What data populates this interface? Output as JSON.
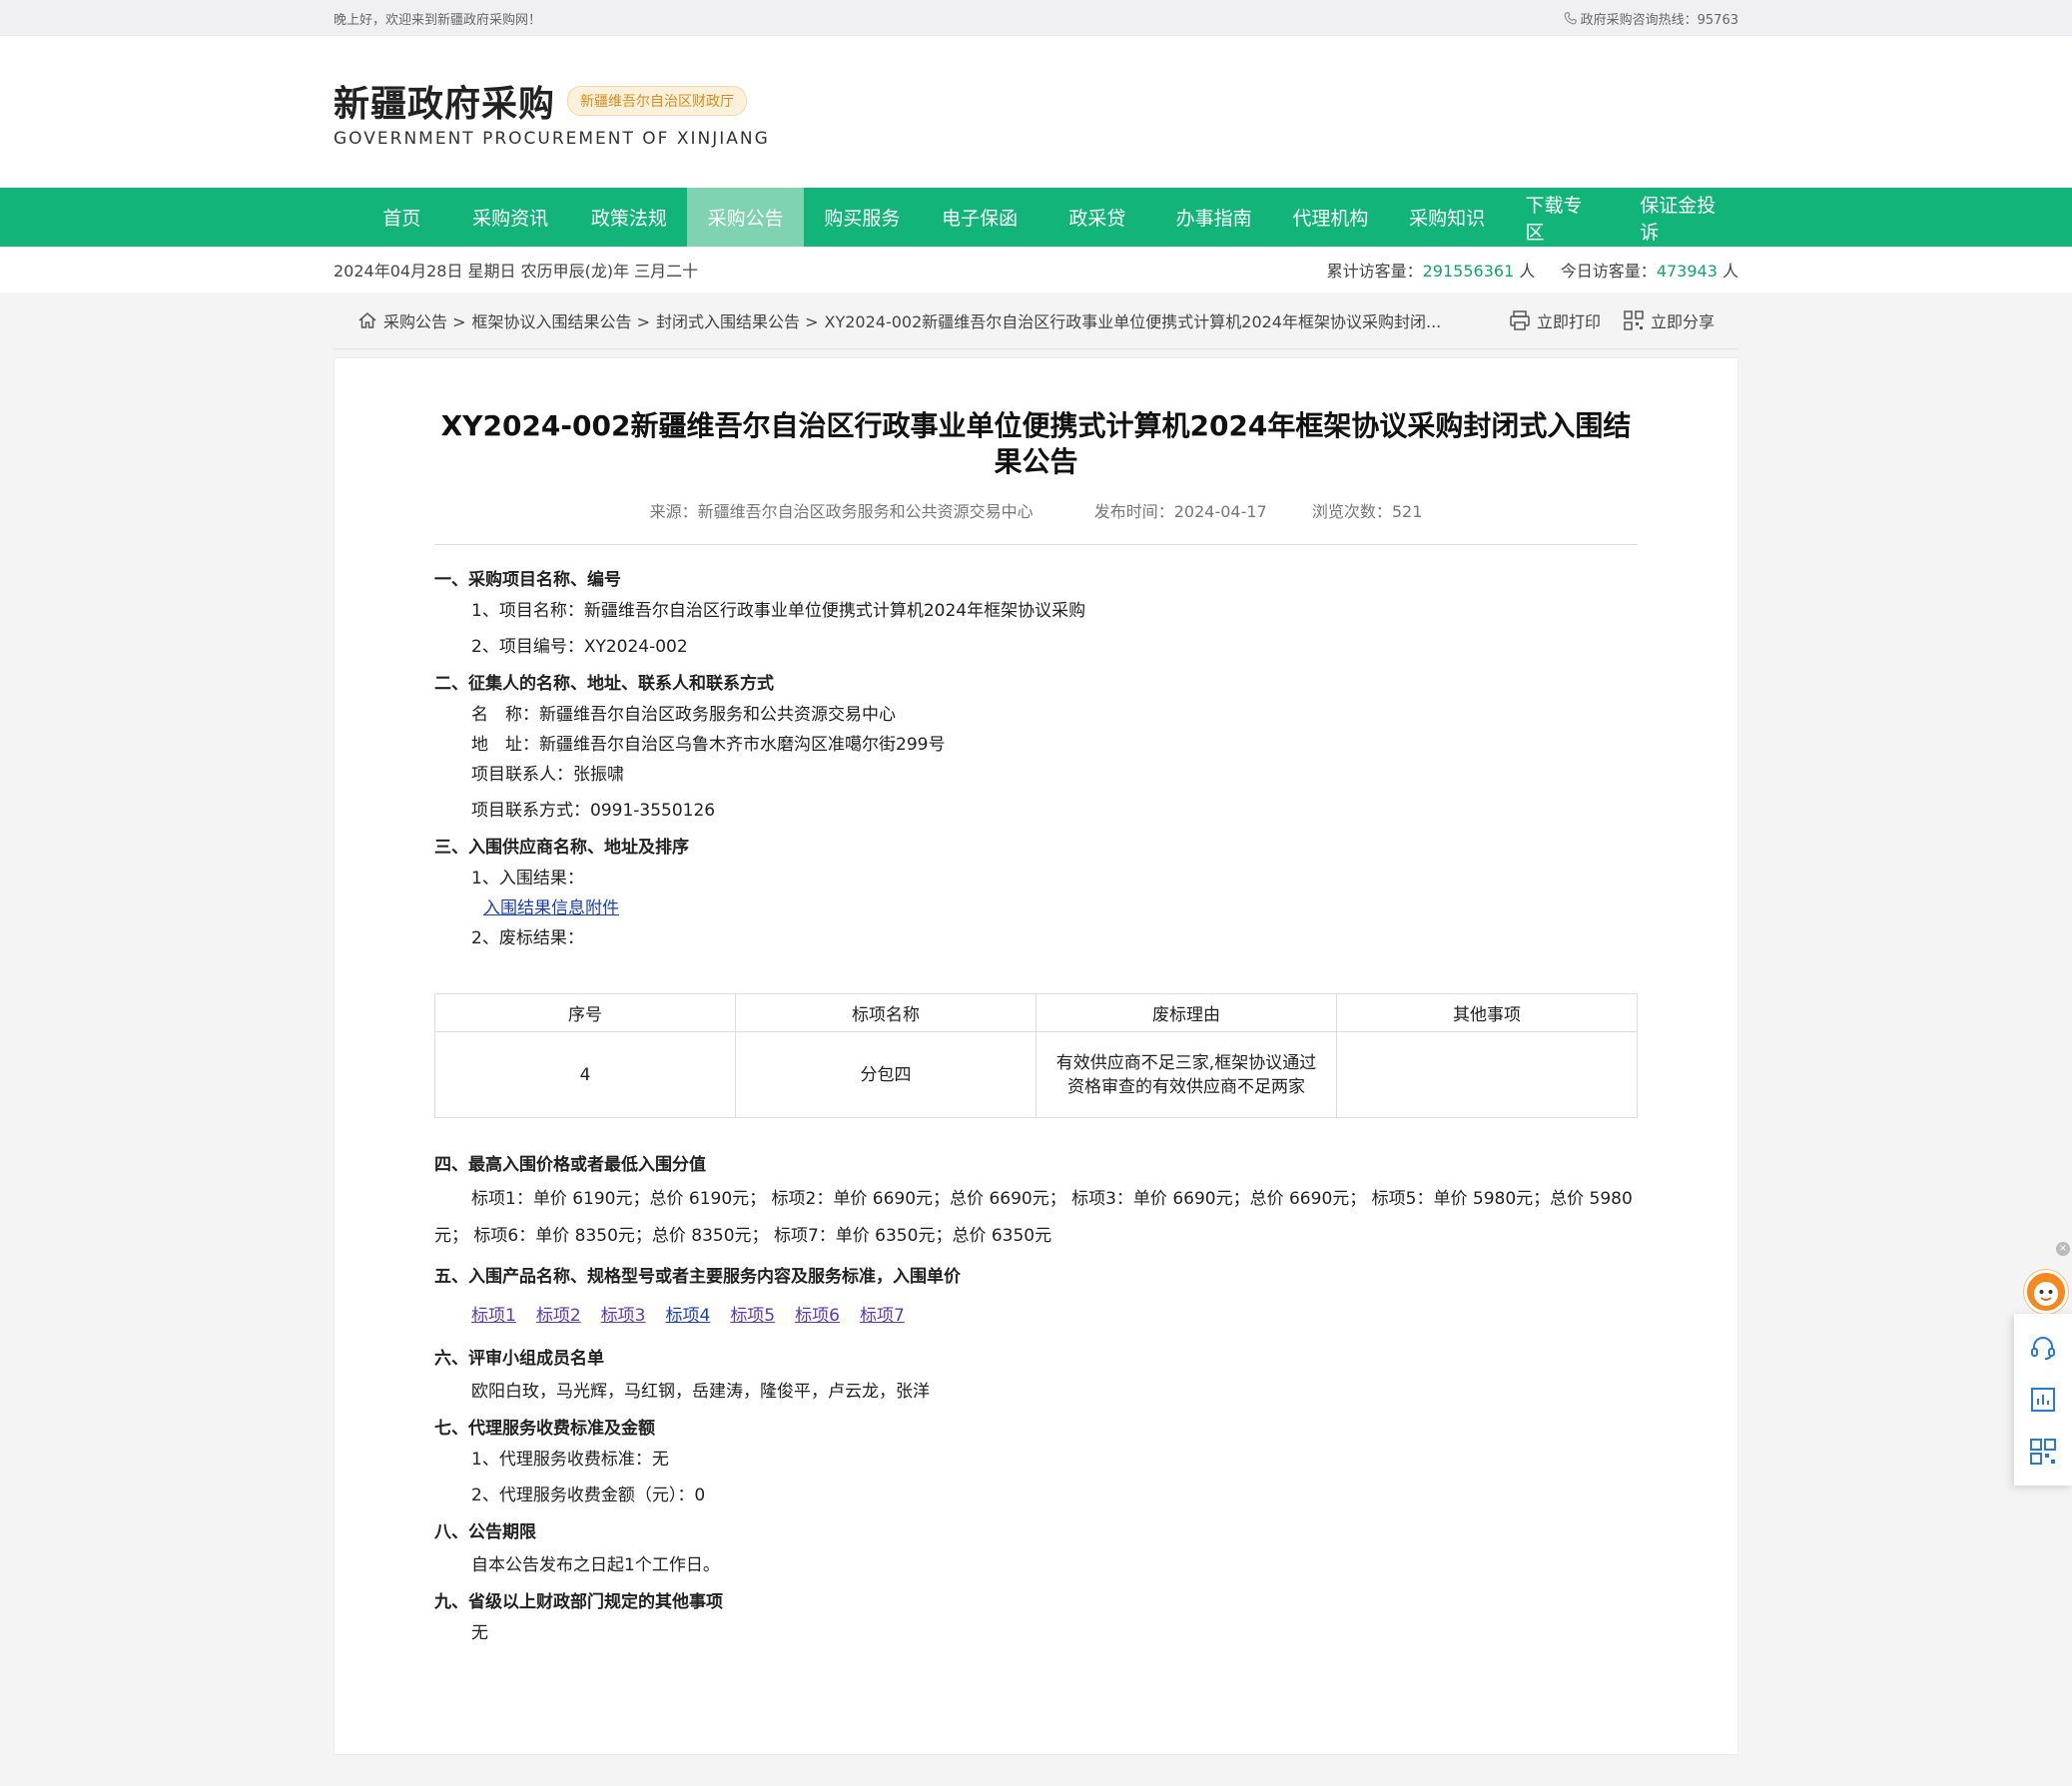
{
  "topbar": {
    "greeting": "晚上好，欢迎来到新疆政府采购网！",
    "hotline": "政府采购咨询热线：95763"
  },
  "header": {
    "logo_cn": "新疆政府采购",
    "logo_badge": "新疆维吾尔自治区财政厅",
    "logo_en": "GOVERNMENT PROCUREMENT OF XINJIANG"
  },
  "nav": {
    "items": [
      "首页",
      "采购资讯",
      "政策法规",
      "采购公告",
      "购买服务",
      "电子保函",
      "政采贷",
      "办事指南",
      "代理机构",
      "采购知识",
      "下载专区",
      "保证金投诉"
    ],
    "active": "采购公告"
  },
  "info": {
    "date": "2024年04月28日 星期日 农历甲辰(龙)年 三月二十",
    "total_label": "累计访客量：",
    "total_value": "291556361",
    "total_unit": "人",
    "today_label": "今日访客量：",
    "today_value": "473943",
    "today_unit": "人"
  },
  "breadcrumb": {
    "items": [
      "采购公告 >",
      "框架协议入围结果公告 >",
      "封闭式入围结果公告 >",
      "XY2024-002新疆维吾尔自治区行政事业单位便携式计算机2024年框架协议采购封闭..."
    ],
    "print": "立即打印",
    "share": "立即分享"
  },
  "article": {
    "title": "XY2024-002新疆维吾尔自治区行政事业单位便携式计算机2024年框架协议采购封闭式入围结果公告",
    "source": "来源：新疆维吾尔自治区政务服务和公共资源交易中心",
    "publish": "发布时间：2024-04-17",
    "views": "浏览次数：521",
    "s1_title": "一、采购项目名称、编号",
    "s1_p1": "1、项目名称：新疆维吾尔自治区行政事业单位便携式计算机2024年框架协议采购",
    "s1_p2": "2、项目编号：XY2024-002",
    "s2_title": "二、征集人的名称、地址、联系人和联系方式",
    "s2_p1": "名　称：新疆维吾尔自治区政务服务和公共资源交易中心",
    "s2_p2": "地　址：新疆维吾尔自治区乌鲁木齐市水磨沟区准噶尔街299号",
    "s2_p3": "项目联系人：张振啸",
    "s2_p4": "项目联系方式：0991-3550126",
    "s3_title": "三、入围供应商名称、地址及排序",
    "s3_p1": "1、入围结果：",
    "s3_link": "入围结果信息附件",
    "s3_p2": "2、废标结果：",
    "table": {
      "headers": [
        "序号",
        "标项名称",
        "废标理由",
        "其他事项"
      ],
      "row": [
        "4",
        "分包四",
        "有效供应商不足三家,框架协议通过资格审查的有效供应商不足两家",
        ""
      ]
    },
    "s4_title": "四、最高入围价格或者最低入围分值",
    "s4_p1": "标项1：单价 6190元；总价 6190元；  标项2：单价 6690元；总价 6690元；  标项3：单价 6690元；总价 6690元；  标项5：单价 5980元；总价 5980元；  标项6：单价 8350元；总价 8350元；  标项7：单价 6350元；总价 6350元",
    "s5_title": "五、入围产品名称、规格型号或者主要服务内容及服务标准，入围单价",
    "s5_links": [
      "标项1",
      "标项2",
      "标项3",
      "标项4",
      "标项5",
      "标项6",
      "标项7"
    ],
    "s6_title": "六、评审小组成员名单",
    "s6_p1": "欧阳白玫，马光辉，马红钢，岳建涛，隆俊平，卢云龙，张洋",
    "s7_title": "七、代理服务收费标准及金额",
    "s7_p1": "1、代理服务收费标准：无",
    "s7_p2": "2、代理服务收费金额（元）：0",
    "s8_title": "八、公告期限",
    "s8_p1": "自本公告发布之日起1个工作日。",
    "s9_title": "九、省级以上财政部门规定的其他事项",
    "s9_p1": "无"
  },
  "colors": {
    "nav_bg": "#12b47a",
    "nav_active": "#7fd3b0",
    "accent_green": "#12a56c",
    "link_blue": "#1a3fb8"
  },
  "icons": [
    "phone-icon",
    "home-icon",
    "printer-icon",
    "qrcode-icon",
    "close-icon",
    "mascot-icon",
    "headset-icon",
    "chart-icon",
    "qrcode-side-icon"
  ]
}
